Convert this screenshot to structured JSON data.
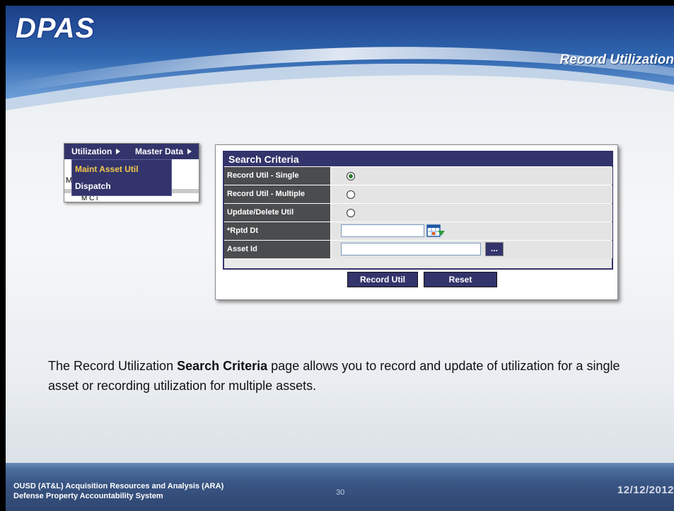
{
  "header": {
    "logo_text": "DPAS",
    "slide_title": "Record Utilization"
  },
  "menu": {
    "top_items": [
      "Utilization",
      "Master Data"
    ],
    "dropdown_items": [
      {
        "label": "Maint Asset Util",
        "color": "#f2c94c"
      },
      {
        "label": "Dispatch",
        "color": "#ffffff"
      }
    ],
    "partial_m": "M",
    "cut_text": "M  C  i"
  },
  "search": {
    "title": "Search Criteria",
    "rows": [
      {
        "label": "Record Util - Single",
        "type": "radio",
        "checked": true
      },
      {
        "label": "Record Util - Multiple",
        "type": "radio",
        "checked": false
      },
      {
        "label": "Update/Delete Util",
        "type": "radio",
        "checked": false
      },
      {
        "label": "*Rptd Dt",
        "type": "date",
        "value": ""
      },
      {
        "label": "Asset Id",
        "type": "text",
        "value": "",
        "lookup_label": "..."
      }
    ],
    "buttons": {
      "record": "Record Util",
      "reset": "Reset"
    }
  },
  "body": {
    "text_before": "The Record Utilization ",
    "text_bold": "Search Criteria",
    "text_after": " page allows you to record and update of utilization for a single asset or recording utilization for multiple assets."
  },
  "footer": {
    "org_line1": "OUSD (AT&L) Acquisition Resources and Analysis (ARA)",
    "org_line2": "Defense Property Accountability System",
    "page_number": "30",
    "date": "12/12/2012"
  },
  "colors": {
    "navy": "#33346b",
    "label_gray": "#4b4c4e",
    "header_blue": "#1f4f8f",
    "footer_blue": "#3a5684"
  }
}
